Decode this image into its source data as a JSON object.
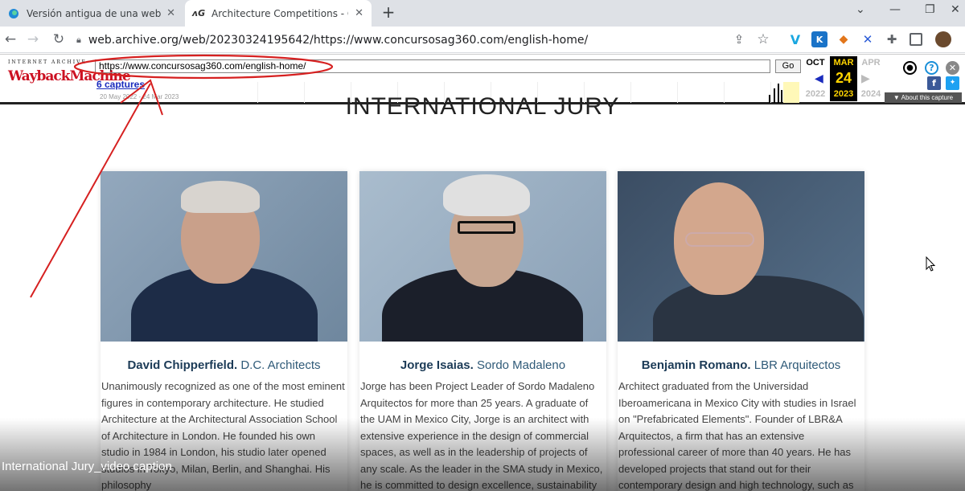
{
  "browser": {
    "tabs": [
      {
        "title": "Versión antigua de una web | Ver",
        "active": false,
        "icon": "edge-icon"
      },
      {
        "title": "Architecture Competitions - Con",
        "active": true,
        "icon": "ag360-icon"
      }
    ],
    "new_tab": "+",
    "window_controls": [
      "⌄",
      "—",
      "❐",
      "✕"
    ],
    "address": "web.archive.org/web/20230324195642/https://www.concursosag360.com/english-home/"
  },
  "wayback": {
    "logo_top": "INTERNET ARCHIVE",
    "logo_main": "WaybackMachine",
    "url_value": "https://www.concursosag360.com/english-home/",
    "go_label": "Go",
    "captures": "6 captures",
    "range": "20 May 2022 - 24 Mar 2023",
    "prev": {
      "month": "OCT",
      "day": "",
      "year": "2022"
    },
    "cur": {
      "month": "MAR",
      "day": "24",
      "year": "2023"
    },
    "next": {
      "month": "APR",
      "day": "",
      "year": "2024"
    },
    "about": "▼ About this capture",
    "annotation_color": "#d62020"
  },
  "page": {
    "title": "INTERNATIONAL JURY",
    "cards": [
      {
        "name": "David Chipperfield.",
        "company": " D.C. Architects",
        "bio": "Unanimously recognized as one of the most eminent figures in contemporary architecture. He studied Architecture at the Architectural Association School of Architecture in London. He founded his own studio in 1984 in London, his studio later opened studios in Tokyo, Milan, Berlin, and Shanghai. His philosophy"
      },
      {
        "name": "Jorge Isaias.",
        "company": " Sordo Madaleno",
        "bio": "Jorge has been Project Leader of Sordo Madaleno Arquitectos for more than 25 years. A graduate of the UAM in Mexico City, Jorge is an architect with extensive experience in the design of commercial spaces, as well as in the leadership of projects of any scale. As the leader in the SMA study in Mexico, he is committed to design excellence, sustainability"
      },
      {
        "name": "Benjamin Romano.",
        "company": " LBR Arquitectos",
        "bio": "Architect graduated from the Universidad Iberoamericana in Mexico City with studies in Israel on \"Prefabricated Elements\". Founder of LBR&A Arquitectos, a firm that has an extensive professional career of more than 40 years. He has developed projects that stand out for their contemporary design and high technology, such as"
      }
    ]
  },
  "caption": "International Jury_video caption"
}
